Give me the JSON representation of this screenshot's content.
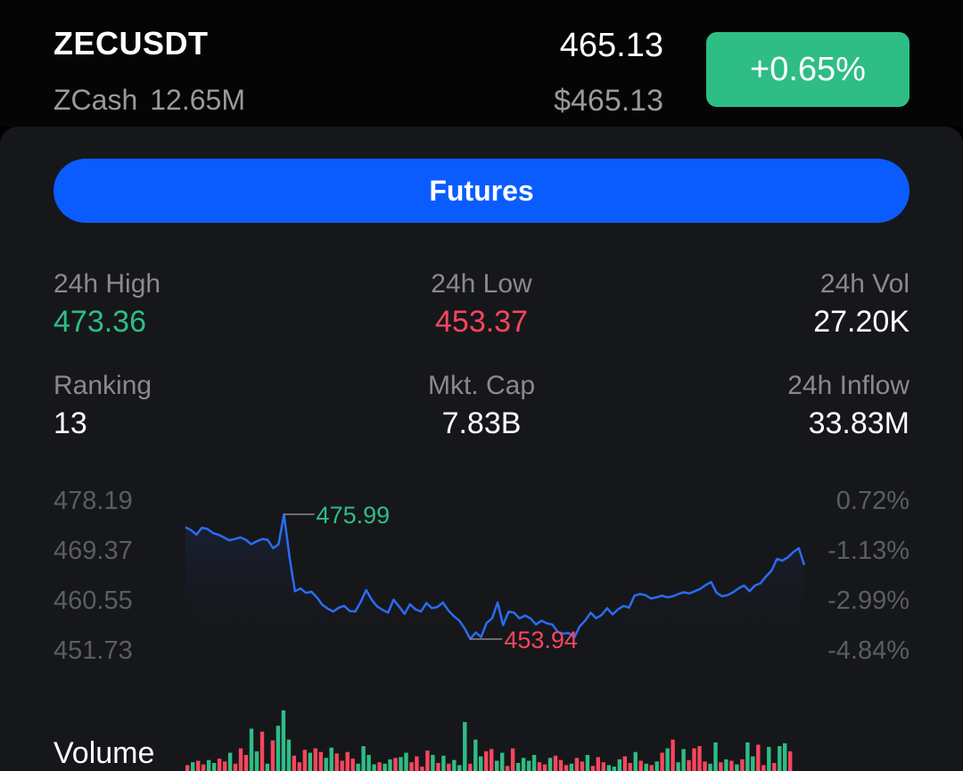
{
  "header": {
    "symbol": "ZECUSDT",
    "coin_name": "ZCash",
    "volume": "12.65M",
    "price": "465.13",
    "usd_price": "$465.13",
    "change": "+0.65%"
  },
  "futures_button": {
    "label": "Futures"
  },
  "stats": {
    "high_label": "24h High",
    "high_value": "473.36",
    "low_label": "24h Low",
    "low_value": "453.37",
    "vol_label": "24h Vol",
    "vol_value": "27.20K",
    "ranking_label": "Ranking",
    "ranking_value": "13",
    "mktcap_label": "Mkt. Cap",
    "mktcap_value": "7.83B",
    "inflow_label": "24h Inflow",
    "inflow_value": "33.83M"
  },
  "chart_data": {
    "type": "line",
    "y_ticks": [
      "478.19",
      "469.37",
      "460.55",
      "451.73"
    ],
    "y_ticks_right": [
      "0.72%",
      "-1.13%",
      "-2.99%",
      "-4.84%"
    ],
    "ylim": [
      451.73,
      478.19
    ],
    "max_label": "475.99",
    "min_label": "453.94",
    "max_index": 18,
    "min_index": 52,
    "values": [
      473.7,
      473.2,
      472.4,
      473.6,
      473.4,
      472.7,
      472.4,
      471.9,
      471.4,
      471.6,
      471.9,
      471.5,
      470.7,
      471.2,
      471.6,
      471.5,
      470.0,
      470.7,
      475.99,
      468.4,
      462.4,
      462.9,
      462.1,
      462.3,
      461.3,
      460.0,
      459.3,
      458.8,
      459.5,
      459.8,
      458.9,
      458.8,
      460.5,
      462.6,
      460.9,
      459.7,
      459.1,
      458.6,
      460.9,
      459.7,
      458.4,
      460.1,
      459.2,
      458.8,
      460.3,
      459.4,
      459.6,
      460.4,
      459.0,
      458.0,
      457.2,
      455.8,
      453.94,
      455.1,
      454.3,
      456.8,
      457.6,
      460.4,
      456.4,
      458.8,
      458.6,
      457.6,
      458.1,
      457.6,
      456.5,
      457.2,
      456.7,
      456.5,
      455.2,
      454.9,
      455.0,
      454.2,
      456.2,
      457.2,
      458.6,
      457.6,
      458.2,
      459.4,
      458.3,
      459.2,
      459.8,
      459.5,
      461.6,
      461.9,
      461.7,
      461.1,
      461.3,
      461.6,
      461.3,
      461.5,
      461.9,
      462.2,
      462.0,
      462.4,
      462.8,
      463.5,
      464.0,
      462.1,
      461.5,
      461.7,
      462.2,
      462.9,
      463.4,
      462.4,
      463.4,
      463.8,
      465.0,
      466.0,
      468.1,
      467.8,
      468.4,
      469.3,
      470.0,
      467.0
    ],
    "volume_label": "Volume",
    "volumes": [
      8,
      12,
      14,
      9,
      15,
      11,
      17,
      13,
      25,
      10,
      31,
      22,
      58,
      27,
      54,
      10,
      42,
      62,
      83,
      43,
      21,
      12,
      29,
      25,
      31,
      26,
      18,
      32,
      24,
      14,
      26,
      17,
      10,
      34,
      22,
      9,
      12,
      10,
      16,
      18,
      19,
      25,
      12,
      20,
      6,
      28,
      22,
      11,
      21,
      10,
      15,
      8,
      67,
      10,
      43,
      20,
      27,
      30,
      14,
      25,
      7,
      31,
      11,
      18,
      14,
      22,
      12,
      9,
      18,
      21,
      15,
      8,
      10,
      18,
      13,
      22,
      7,
      19,
      12,
      8,
      6,
      16,
      20,
      11,
      26,
      14,
      10,
      8,
      13,
      25,
      31,
      43,
      12,
      30,
      15,
      31,
      34,
      13,
      10,
      39,
      12,
      16,
      14,
      9,
      16,
      39,
      20,
      36,
      8,
      33,
      11,
      34,
      38,
      27
    ],
    "volume_colors": [
      "red",
      "green",
      "red",
      "red",
      "green",
      "green",
      "red",
      "red",
      "green",
      "red",
      "red",
      "red",
      "green",
      "green",
      "red",
      "green",
      "red",
      "green",
      "green",
      "green",
      "red",
      "red",
      "red",
      "green",
      "red",
      "red",
      "green",
      "green",
      "red",
      "red",
      "red",
      "red",
      "green",
      "green",
      "green",
      "green",
      "red",
      "green",
      "green",
      "red",
      "green",
      "green",
      "red",
      "red",
      "red",
      "red",
      "green",
      "red",
      "green",
      "red",
      "green",
      "green",
      "green",
      "red",
      "green",
      "green",
      "red",
      "red",
      "green",
      "green",
      "red",
      "red",
      "green",
      "green",
      "green",
      "green",
      "red",
      "red",
      "green",
      "red",
      "red",
      "red",
      "green",
      "red",
      "red",
      "green",
      "red",
      "red",
      "red",
      "green",
      "green",
      "green",
      "red",
      "red",
      "green",
      "red",
      "green",
      "red",
      "green",
      "red",
      "green",
      "red",
      "green",
      "green",
      "red",
      "red",
      "red",
      "red",
      "green",
      "green",
      "red",
      "green",
      "red",
      "green",
      "red",
      "green",
      "green",
      "red",
      "red",
      "green",
      "red",
      "green",
      "green",
      "red"
    ]
  },
  "colors": {
    "green": "#2ebd85",
    "red": "#f6465d",
    "line": "#2a6cf2",
    "accent": "#0a5cff"
  }
}
